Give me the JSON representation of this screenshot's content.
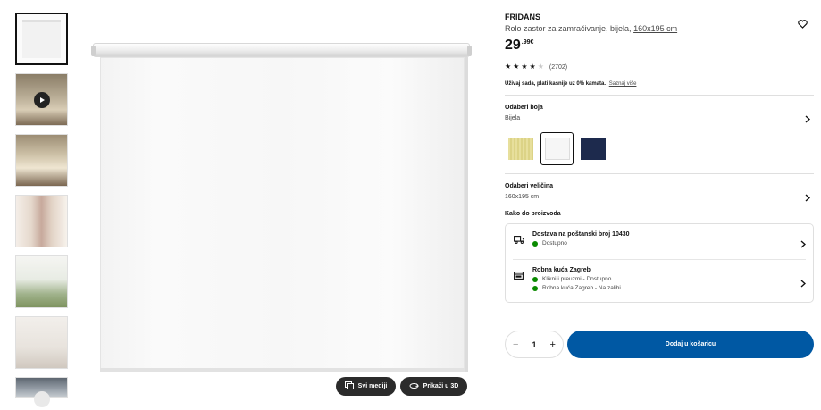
{
  "product": {
    "name": "FRIDANS",
    "description": "Rolo zastor za zamračivanje, bijela,",
    "size_link": "160x195 cm",
    "price_main": "29",
    "price_decimal": ".99€",
    "rating_count": "(2702)",
    "rating_stars": 4,
    "rating_max": 5,
    "klarna_text": "Uživaj sada, plati kasnije uz 0% kamata.",
    "klarna_more": "Saznaj više"
  },
  "color_select": {
    "label": "Odaberi boja",
    "value": "Bijela",
    "swatch_colors": [
      "#e7df9c",
      "#f6f6f6",
      "#1d2a4d"
    ]
  },
  "size_select": {
    "label": "Odaberi veličina",
    "value": "160x195 cm"
  },
  "availability": {
    "heading": "Kako do proizvoda",
    "delivery_title": "Dostava na poštanski broj 10430",
    "delivery_status": "Dostupno",
    "store_title": "Robna kuća Zagreb",
    "store_line1": "Klikni i preuzmi - Dostupno",
    "store_line2": "Robna kuća Zagreb - Na zalihi",
    "status_color": "#0a8a00"
  },
  "media": {
    "all_media": "Svi mediji",
    "view_3d": "Prikaži u 3D"
  },
  "cart": {
    "quantity": "1",
    "minus": "−",
    "plus": "+",
    "add_label": "Dodaj u košaricu",
    "accent": "#0058a3"
  }
}
